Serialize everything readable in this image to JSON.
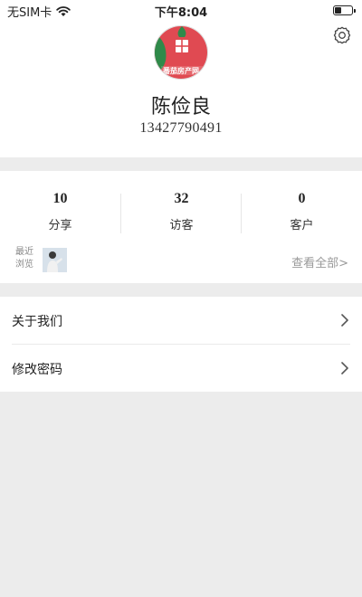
{
  "status_bar": {
    "carrier": "无SIM卡",
    "time": "下午8:04",
    "battery_level": 0.4
  },
  "profile": {
    "name": "陈俭良",
    "phone": "13427790491",
    "avatar_text": "番茄房产网",
    "settings_icon": "gear-icon"
  },
  "stats": [
    {
      "value": "10",
      "label": "分享"
    },
    {
      "value": "32",
      "label": "访客"
    },
    {
      "value": "0",
      "label": "客户"
    }
  ],
  "recent": {
    "label_line1": "最近",
    "label_line2": "浏览",
    "view_all": "查看全部>"
  },
  "menu": [
    {
      "label": "关于我们"
    },
    {
      "label": "修改密码"
    }
  ],
  "colors": {
    "background": "#ececec",
    "brand_red": "#e0414b",
    "brand_green": "#2f8a4a"
  }
}
